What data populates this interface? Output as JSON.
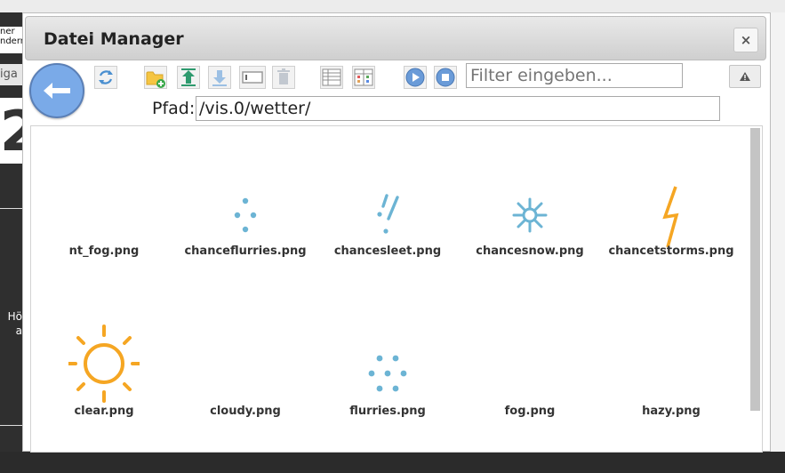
{
  "background": {
    "frag1": "ner ndern:",
    "frag2": "iga",
    "frag3": "2",
    "frag4": "Hö a"
  },
  "dialog": {
    "title": "Datei Manager",
    "close_label": "×",
    "filter_placeholder": "Filter eingeben...",
    "path_label": "Pfad:",
    "path_value": "/vis.0/wetter/"
  },
  "files": [
    {
      "name": "nt_fog.png",
      "icon": "none"
    },
    {
      "name": "chanceflurries.png",
      "icon": "flurries-small-icon"
    },
    {
      "name": "chancesleet.png",
      "icon": "sleet-icon"
    },
    {
      "name": "chancesnow.png",
      "icon": "snowflake-icon"
    },
    {
      "name": "chancetstorms.png",
      "icon": "lightning-icon"
    },
    {
      "name": "clear.png",
      "icon": "sun-icon"
    },
    {
      "name": "cloudy.png",
      "icon": "none"
    },
    {
      "name": "flurries.png",
      "icon": "flurries-icon"
    },
    {
      "name": "fog.png",
      "icon": "none"
    },
    {
      "name": "hazy.png",
      "icon": "none"
    }
  ],
  "colors": {
    "weather_blue": "#6cb4d4",
    "weather_orange": "#f5a623",
    "back_button": "#7aaae8"
  }
}
